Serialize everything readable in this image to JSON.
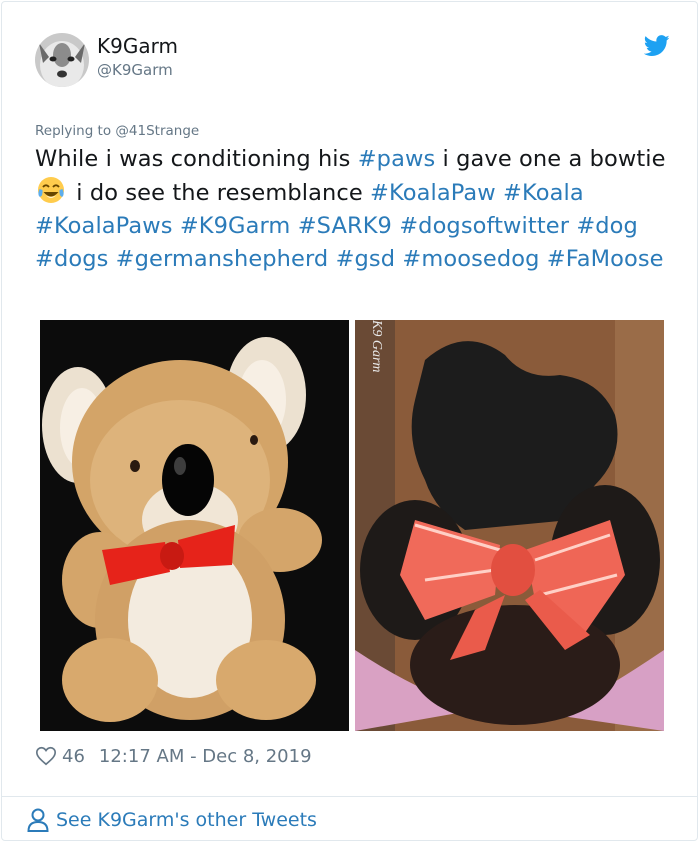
{
  "user": {
    "name": "K9Garm",
    "handle": "@K9Garm"
  },
  "reply": {
    "text": "Replying to @41Strange"
  },
  "tweet": {
    "t1": "While i was conditioning his ",
    "tag_paws": "#paws",
    "t2": " i gave one a bowtie",
    "emoji_name": "face-with-tears-of-joy-emoji",
    "t3": " i do see the resemblance ",
    "tag_koalapaw": "#KoalaPaw",
    "tag_koala": "#Koala",
    "tag_koalapaws": "#KoalaPaws",
    "tag_k9garm": "#K9Garm",
    "tag_sark9": "#SARK9",
    "tag_dogsoftwitter": "#dogsoftwitter",
    "tag_dog": "#dog",
    "tag_dogs": "#dogs",
    "tag_germanshepherd": "#germanshepherd",
    "tag_gsd": "#gsd",
    "tag_moosedog": "#moosedog",
    "tag_famoose": "#FaMoose"
  },
  "media": {
    "watermark": "K9 Garm"
  },
  "meta": {
    "likes": "46",
    "timestamp": "12:17 AM - Dec 8, 2019"
  },
  "footer": {
    "see_more": "See K9Garm's other Tweets"
  },
  "colors": {
    "link": "#2b7bb9",
    "muted": "#657786",
    "twitter_blue": "#1da1f2"
  },
  "icons": [
    "twitter-bird-icon",
    "heart-icon",
    "person-icon",
    "face-with-tears-of-joy-emoji"
  ]
}
